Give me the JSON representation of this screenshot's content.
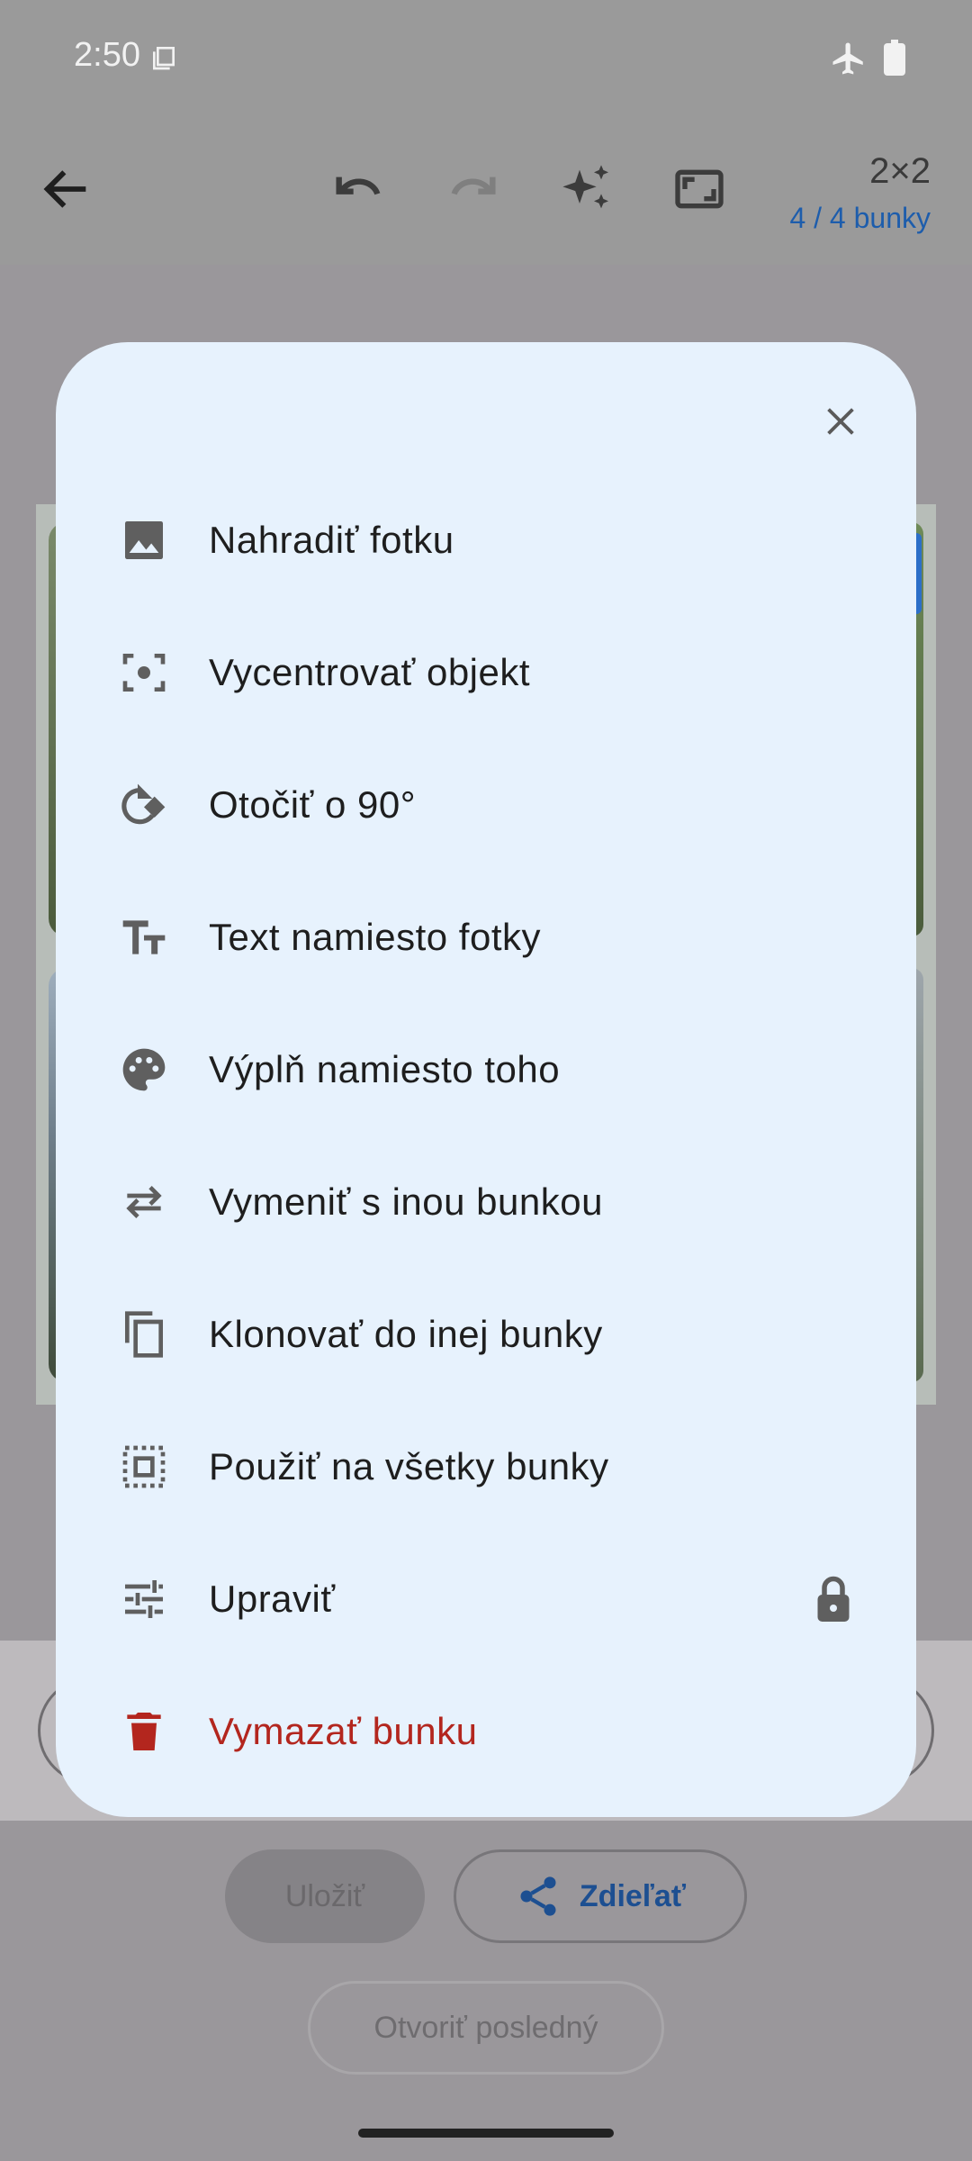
{
  "status_bar": {
    "time": "2:50",
    "icons": [
      "document-icon",
      "airplane-icon",
      "battery-icon"
    ]
  },
  "app_bar": {
    "icons": [
      "back-arrow-icon",
      "undo-icon",
      "redo-icon",
      "sparkle-icon",
      "aspect-ratio-icon"
    ],
    "grid": "2×2",
    "cells": "4 / 4 bunky"
  },
  "sheet": {
    "close_icon": "close-icon",
    "items": [
      {
        "label": "Nahradiť fotku",
        "icon": "image-icon"
      },
      {
        "label": "Vycentrovať objekt",
        "icon": "center-focus-icon"
      },
      {
        "label": "Otočiť o 90°",
        "icon": "rotate-icon"
      },
      {
        "label": "Text namiesto fotky",
        "icon": "text-fields-icon"
      },
      {
        "label": "Výplň namiesto toho",
        "icon": "palette-icon"
      },
      {
        "label": "Vymeniť s inou bunkou",
        "icon": "swap-icon"
      },
      {
        "label": "Klonovať do inej bunky",
        "icon": "copy-icon"
      },
      {
        "label": "Použiť na všetky bunky",
        "icon": "select-all-icon"
      },
      {
        "label": "Upraviť",
        "icon": "tune-icon",
        "locked": true
      },
      {
        "label": "Vymazať bunku",
        "icon": "delete-icon",
        "danger": true
      }
    ]
  },
  "footer": {
    "save_label": "Uložiť",
    "share_label": "Zdieľať",
    "open_last_label": "Otvoriť posledný"
  },
  "colors": {
    "sheet_bg": "#e7f2fd",
    "scrim": "#9a979b",
    "danger": "#b3261e",
    "accent": "#1d5dac",
    "icon": "#5f5f5f"
  }
}
